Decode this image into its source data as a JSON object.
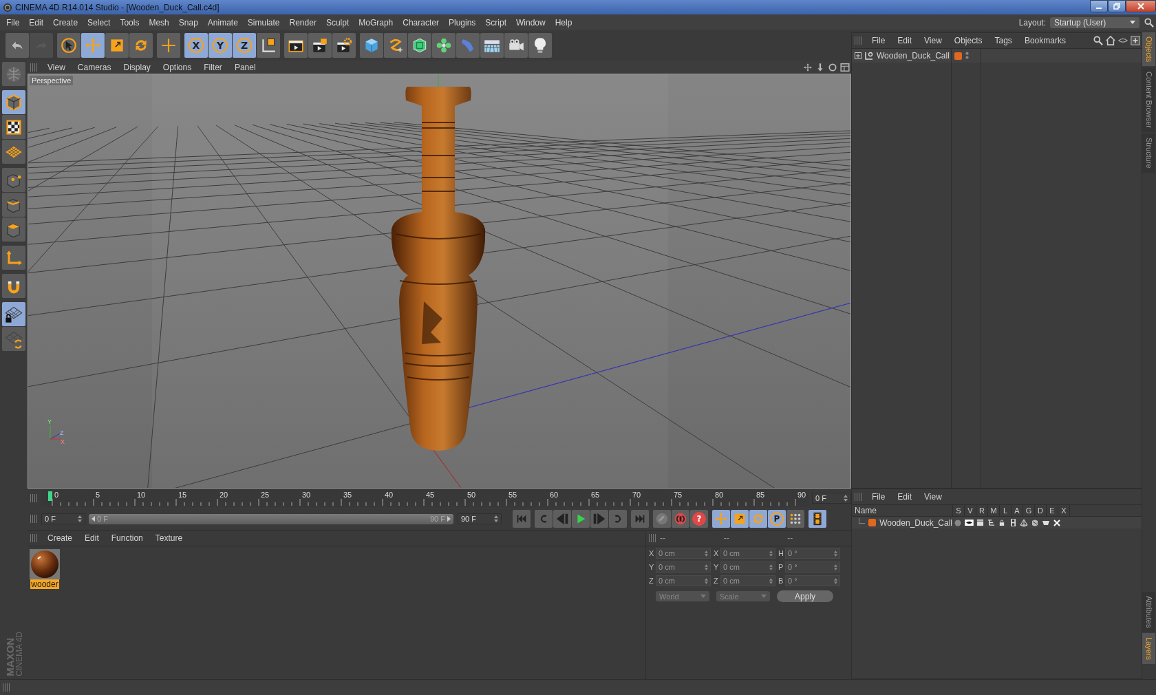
{
  "window": {
    "title": "CINEMA 4D R14.014 Studio - [Wooden_Duck_Call.c4d]"
  },
  "menu": [
    "File",
    "Edit",
    "Create",
    "Select",
    "Tools",
    "Mesh",
    "Snap",
    "Animate",
    "Simulate",
    "Render",
    "Sculpt",
    "MoGraph",
    "Character",
    "Plugins",
    "Script",
    "Window",
    "Help"
  ],
  "layout": {
    "label": "Layout:",
    "value": "Startup (User)"
  },
  "toolbar": [
    {
      "tools": [
        {
          "kind": "undo",
          "selected": false,
          "disabled": false
        },
        {
          "kind": "redo",
          "selected": false,
          "disabled": true
        }
      ]
    },
    {
      "tools": [
        {
          "kind": "select",
          "selected": false
        },
        {
          "kind": "move",
          "selected": true
        },
        {
          "kind": "scale",
          "selected": false
        },
        {
          "kind": "rotate",
          "selected": false
        }
      ]
    },
    {
      "tools": [
        {
          "kind": "add",
          "selected": false
        }
      ]
    },
    {
      "tools": [
        {
          "kind": "axis",
          "label": "X",
          "selected": true
        },
        {
          "kind": "axis",
          "label": "Y",
          "selected": true
        },
        {
          "kind": "axis",
          "label": "Z",
          "selected": true
        },
        {
          "kind": "coords",
          "selected": false
        }
      ]
    },
    {
      "tools": [
        {
          "kind": "render-view",
          "selected": false
        },
        {
          "kind": "render-picture",
          "selected": false
        },
        {
          "kind": "render-settings",
          "selected": false
        }
      ]
    },
    {
      "tools": [
        {
          "kind": "cube",
          "selected": false
        },
        {
          "kind": "spline",
          "selected": false
        },
        {
          "kind": "subdivision",
          "selected": false
        },
        {
          "kind": "cloner",
          "selected": false
        },
        {
          "kind": "deformer",
          "selected": false
        },
        {
          "kind": "floor",
          "selected": false
        },
        {
          "kind": "camera",
          "selected": false
        },
        {
          "kind": "light",
          "selected": false
        }
      ]
    }
  ],
  "left_tools": [
    {
      "tools": [
        {
          "kind": "model",
          "selected": false
        }
      ]
    },
    {
      "tools": [
        {
          "kind": "object",
          "selected": true
        },
        {
          "kind": "texture",
          "selected": false
        },
        {
          "kind": "workplane",
          "selected": false
        }
      ]
    },
    {
      "tools": [
        {
          "kind": "points",
          "selected": false
        },
        {
          "kind": "edges",
          "selected": false
        },
        {
          "kind": "polygons",
          "selected": false
        }
      ]
    },
    {
      "tools": [
        {
          "kind": "axis-mode",
          "selected": false
        }
      ]
    },
    {
      "tools": [
        {
          "kind": "magnet",
          "selected": false
        }
      ]
    },
    {
      "tools": [
        {
          "kind": "locked-workplane",
          "selected": true
        },
        {
          "kind": "planar-workplane",
          "selected": false
        }
      ]
    }
  ],
  "logo": {
    "lines": [
      "MAXON",
      "CINEMA 4D"
    ]
  },
  "viewport": {
    "menu": [
      "View",
      "Cameras",
      "Display",
      "Options",
      "Filter",
      "Panel"
    ],
    "label": "Perspective",
    "axis_labels": [
      "Y",
      "Z",
      "X"
    ]
  },
  "timeline": {
    "ticks": [
      "0",
      "5",
      "10",
      "15",
      "20",
      "25",
      "30",
      "35",
      "40",
      "45",
      "50",
      "55",
      "60",
      "65",
      "70",
      "75",
      "80",
      "85",
      "90"
    ],
    "current": "0 F",
    "start": "0 F",
    "range": {
      "start": "0 F",
      "end": "90 F",
      "level": 1
    },
    "end": "90 F"
  },
  "playback": [
    {
      "tools": [
        {
          "kind": "first",
          "selected": false
        }
      ]
    },
    {
      "tools": [
        {
          "kind": "prev-key",
          "selected": false
        },
        {
          "kind": "prev-frame",
          "selected": false
        },
        {
          "kind": "play",
          "selected": false
        },
        {
          "kind": "next-frame",
          "selected": false
        },
        {
          "kind": "next-key",
          "selected": false
        }
      ]
    },
    {
      "tools": [
        {
          "kind": "last",
          "selected": false
        }
      ]
    },
    {
      "tools": [
        {
          "kind": "record",
          "selected": false
        },
        {
          "kind": "auto-key",
          "selected": false
        },
        {
          "kind": "help",
          "label": "?",
          "selected": false
        }
      ]
    },
    {
      "tools": [
        {
          "kind": "move",
          "selected": true
        },
        {
          "kind": "scale",
          "selected": true
        },
        {
          "kind": "rotate",
          "selected": true
        },
        {
          "kind": "param",
          "label": "P",
          "selected": true
        },
        {
          "kind": "points-grid",
          "selected": false
        }
      ]
    },
    {
      "tools": [
        {
          "kind": "film",
          "selected": true
        }
      ]
    }
  ],
  "materials": {
    "menu": [
      "Create",
      "Edit",
      "Function",
      "Texture"
    ],
    "items": [
      {
        "name": "wooder",
        "selected": true
      }
    ]
  },
  "coordinates": {
    "headers": [
      "--",
      "--",
      "--"
    ],
    "rows": [
      {
        "axis": "X",
        "value": "0 cm",
        "size_axis": "X",
        "size": "0 cm",
        "rot_axis": "H",
        "rot": "0 °"
      },
      {
        "axis": "Y",
        "value": "0 cm",
        "size_axis": "Y",
        "size": "0 cm",
        "rot_axis": "P",
        "rot": "0 °"
      },
      {
        "axis": "Z",
        "value": "0 cm",
        "size_axis": "Z",
        "size": "0 cm",
        "rot_axis": "B",
        "rot": "0 °"
      }
    ],
    "mode": "World",
    "size_mode": "Scale",
    "apply": "Apply"
  },
  "objects": {
    "menu": [
      "File",
      "Edit",
      "View",
      "Objects",
      "Tags",
      "Bookmarks"
    ],
    "items": [
      {
        "name": "Wooden_Duck_Call",
        "color": "#e0691f"
      }
    ]
  },
  "layer_manager": {
    "menu": [
      "File",
      "Edit",
      "View"
    ],
    "columns": [
      "Name",
      "S",
      "V",
      "R",
      "M",
      "L",
      "A",
      "G",
      "D",
      "E",
      "X"
    ],
    "rows": [
      {
        "name": "Wooden_Duck_Call",
        "color": "#e0691f"
      }
    ]
  },
  "side_tabs_top": [
    {
      "label": "Objects",
      "selected": true
    },
    {
      "label": "Content Browser",
      "selected": false
    },
    {
      "label": "Structure",
      "selected": false
    }
  ],
  "side_tabs_bottom": [
    {
      "label": "Attributes",
      "selected": false
    },
    {
      "label": "Layers",
      "selected": true
    }
  ]
}
